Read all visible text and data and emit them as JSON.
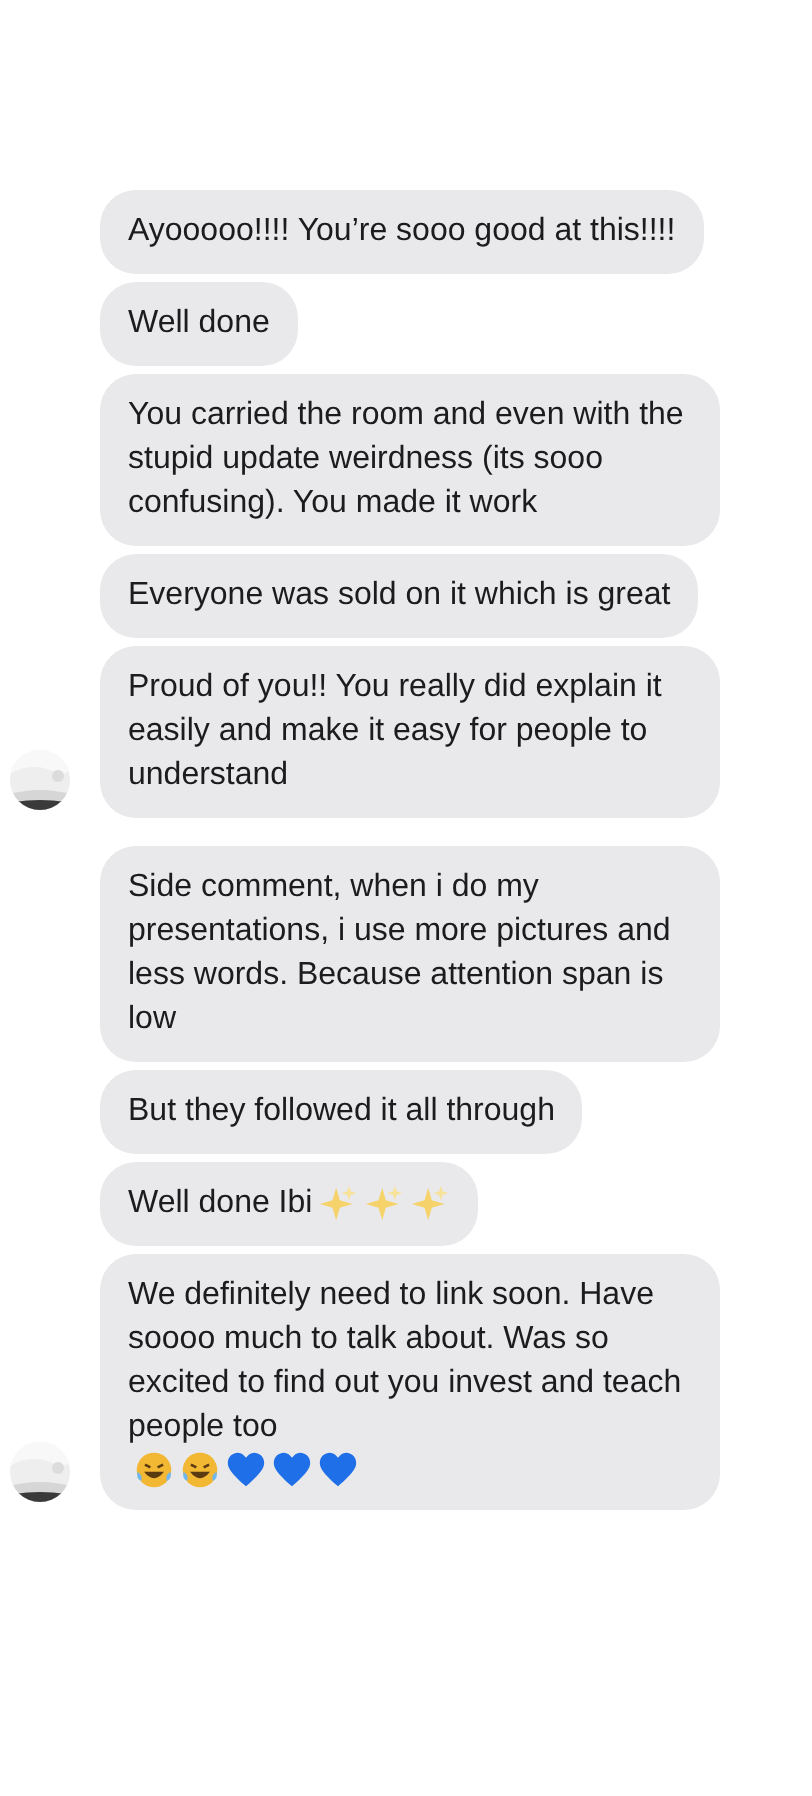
{
  "groups": [
    {
      "avatar": {
        "kind": "picture"
      },
      "messages": [
        {
          "text": "Ayooooo!!!! You’re sooo good at this!!!!"
        },
        {
          "text": "Well done"
        },
        {
          "text": "You carried the room and even with the stupid update weirdness (its sooo confusing). You made it work"
        },
        {
          "text": "Everyone was sold on it which is great"
        },
        {
          "text": "Proud of you!! You really did explain it easily and make it easy for people to understand"
        }
      ]
    },
    {
      "avatar": {
        "kind": "picture"
      },
      "messages": [
        {
          "text": "Side comment, when i do my presentations, i use more pictures and less words. Because attention span is low"
        },
        {
          "text": "But they followed it all through"
        },
        {
          "text": "Well done Ibi",
          "emoji": [
            {
              "kind": "sparkles"
            },
            {
              "kind": "sparkles"
            },
            {
              "kind": "sparkles"
            }
          ]
        },
        {
          "text": "We definitely need to link soon. Have soooo much to talk about. Was so excited to find out you invest and teach people too",
          "emoji": [
            {
              "kind": "laughing"
            },
            {
              "kind": "laughing"
            },
            {
              "kind": "heart"
            },
            {
              "kind": "heart"
            },
            {
              "kind": "heart"
            }
          ]
        }
      ]
    }
  ]
}
